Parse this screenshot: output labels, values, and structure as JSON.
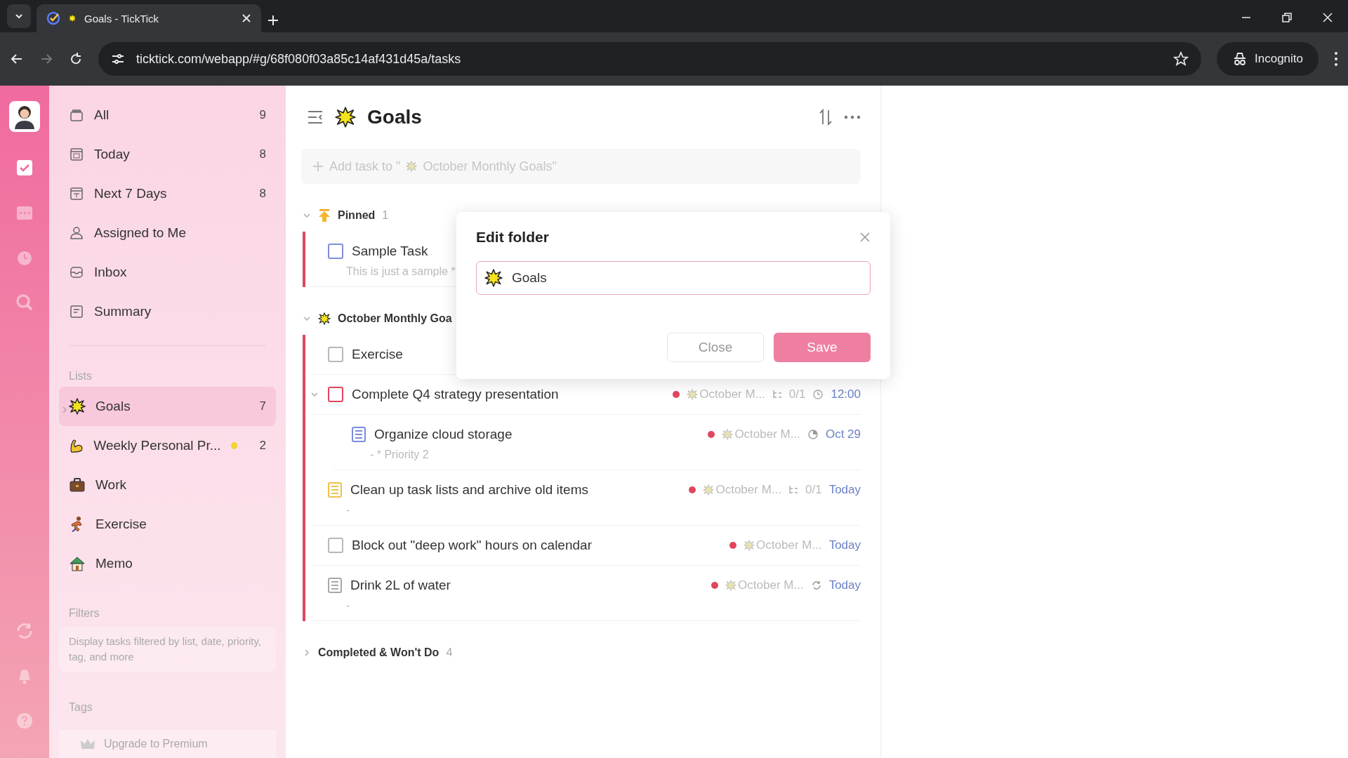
{
  "browser": {
    "tab_title": "Goals - TickTick",
    "url": "ticktick.com/webapp/#g/68f080f03a85c14af431d45a/tasks",
    "profile_label": "Incognito"
  },
  "rail": {
    "items": [
      {
        "kind": "tasks",
        "selected": true
      },
      {
        "kind": "calendar",
        "selected": false
      },
      {
        "kind": "clock",
        "selected": false
      },
      {
        "kind": "search",
        "selected": false
      }
    ],
    "bottom": [
      {
        "kind": "sync"
      },
      {
        "kind": "bell"
      },
      {
        "kind": "help"
      }
    ]
  },
  "sidebar": {
    "smart_lists": [
      {
        "kind": "all",
        "label": "All",
        "count": "9"
      },
      {
        "kind": "today",
        "label": "Today",
        "count": "8"
      },
      {
        "kind": "week",
        "label": "Next 7 Days",
        "count": "8"
      },
      {
        "kind": "assigned",
        "label": "Assigned to Me"
      },
      {
        "kind": "inbox",
        "label": "Inbox"
      },
      {
        "kind": "summary",
        "label": "Summary"
      }
    ],
    "lists_heading": "Lists",
    "lists": [
      {
        "kind": "star",
        "label": "Goals",
        "count": "7",
        "selected": true,
        "folder": true,
        "dot": false
      },
      {
        "kind": "arm",
        "label": "Weekly Personal Pr...",
        "count": "2",
        "selected": false,
        "folder": false,
        "dot": true
      },
      {
        "kind": "briefcase",
        "label": "Work",
        "selected": false,
        "folder": false,
        "dot": false
      },
      {
        "kind": "runner",
        "label": "Exercise",
        "selected": false,
        "folder": false,
        "dot": false
      },
      {
        "kind": "house",
        "label": "Memo",
        "selected": false,
        "folder": false,
        "dot": false
      }
    ],
    "filters_heading": "Filters",
    "filters_hint": "Display tasks filtered by list, date, priority, tag, and more",
    "tags_heading": "Tags",
    "upgrade": "Upgrade to Premium"
  },
  "main": {
    "title": "Goals",
    "add_task_before": "Add task to \"",
    "add_task_after": "October Monthly Goals\"",
    "sections": [
      {
        "kind": "pinned",
        "title": "Pinned",
        "count": "1",
        "expanded": true,
        "tasks": [
          {
            "kind": "checkbox",
            "color": "#7f8fd6",
            "title": "Sample Task",
            "note": "This is just a sample *"
          }
        ]
      },
      {
        "kind": "list",
        "title": "October Monthly Goa",
        "expanded": true,
        "tasks": [
          {
            "kind": "checkbox",
            "color": "#b8b8b8",
            "title": "Exercise"
          },
          {
            "kind": "checkbox",
            "color": "#e0465e",
            "title": "Complete Q4 strategy presentation",
            "expanded": true,
            "dot": true,
            "list": "October M...",
            "subtasks": "0/1",
            "due": {
              "kind": "clock",
              "text": "12:00"
            },
            "children": [
              {
                "kind": "note",
                "color": "#7b8be0",
                "title": "Organize cloud storage",
                "note": "- * Priority 2",
                "dot": true,
                "list": "October M...",
                "due": {
                  "kind": "pie",
                  "text": "Oct 29"
                }
              }
            ]
          },
          {
            "kind": "note",
            "color": "#f0c24a",
            "title": "Clean up task lists and archive old items",
            "note": "-",
            "dot": true,
            "list": "October M...",
            "subtasks": "0/1",
            "due": {
              "kind": "plain",
              "text": "Today"
            }
          },
          {
            "kind": "checkbox",
            "color": "#b8b8b8",
            "title": "Block out \"deep work\" hours on calendar",
            "dot": true,
            "list": "October M...",
            "due": {
              "kind": "plain",
              "text": "Today"
            }
          },
          {
            "kind": "note",
            "color": "#a8a8a8",
            "title": "Drink 2L of water",
            "note": "-",
            "dot": true,
            "list": "October M...",
            "due": {
              "kind": "repeat",
              "text": "Today"
            }
          }
        ]
      },
      {
        "kind": "completed",
        "title": "Completed & Won't Do",
        "count": "4",
        "expanded": false
      }
    ]
  },
  "dialog": {
    "title": "Edit folder",
    "value": "Goals",
    "buttons": [
      {
        "label": "Close",
        "kind": "secondary"
      },
      {
        "label": "Save",
        "kind": "primary"
      }
    ]
  }
}
